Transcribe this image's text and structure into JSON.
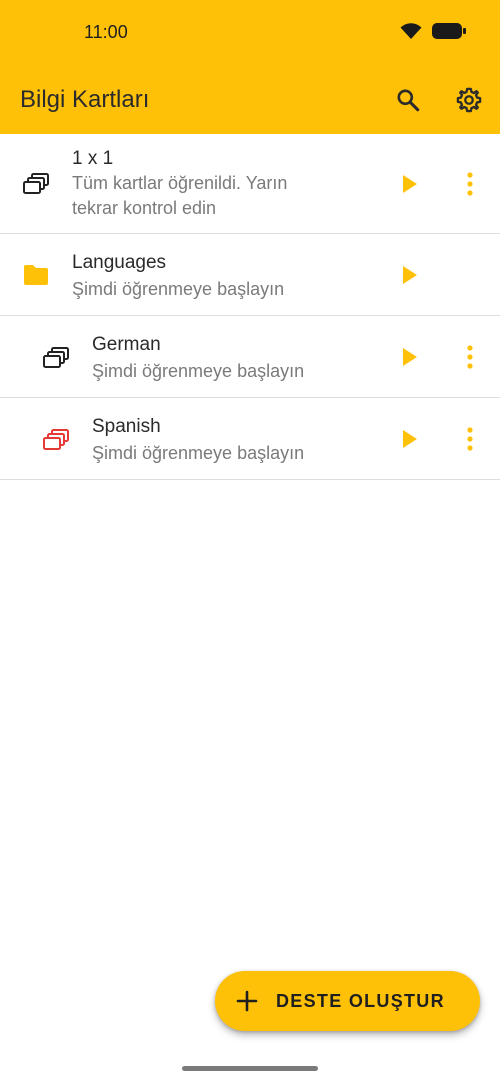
{
  "status_bar": {
    "time": "11:00"
  },
  "app_bar": {
    "title": "Bilgi Kartları"
  },
  "list": {
    "items": [
      {
        "title": "1 x 1",
        "subtitle_line1": "Tüm kartlar öğrenildi. Yarın",
        "subtitle_line2": "tekrar kontrol edin"
      },
      {
        "title": "Languages",
        "subtitle": "Şimdi öğrenmeye başlayın"
      },
      {
        "title": "German",
        "subtitle": "Şimdi öğrenmeye başlayın"
      },
      {
        "title": "Spanish",
        "subtitle": "Şimdi öğrenmeye başlayın"
      }
    ]
  },
  "fab": {
    "label": "DESTE OLUŞTUR"
  },
  "colors": {
    "accent": "#FFC107",
    "deck_red": "#E53935",
    "text_secondary": "#7a7a7a"
  },
  "icons": [
    "wifi-icon",
    "battery-icon",
    "search-icon",
    "gear-icon",
    "deck-icon",
    "folder-icon",
    "play-icon",
    "more-vert-icon",
    "plus-icon"
  ]
}
